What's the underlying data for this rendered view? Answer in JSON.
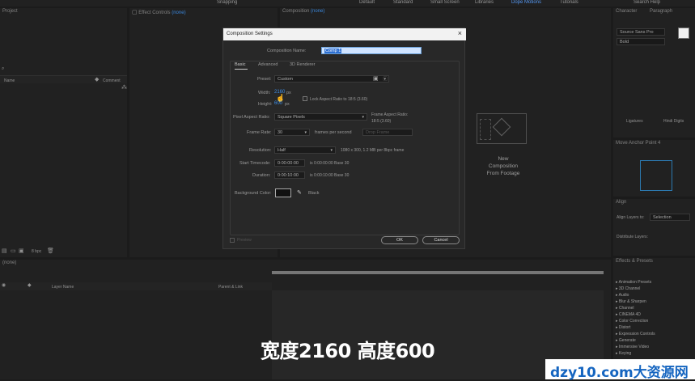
{
  "workspace": {
    "tabs": [
      "Default",
      "Standard",
      "Small Screen",
      "Libraries",
      "Dope Motions",
      "Tutorials"
    ],
    "active": "Dope Motions",
    "search": "Search Help",
    "snapping": "Snapping"
  },
  "panels": {
    "project": "Project",
    "effect_controls": "Effect Controls",
    "effect_controls_value": "(none)",
    "composition": "Composition",
    "composition_value": "(none)",
    "character": "Character",
    "paragraph": "Paragraph",
    "font": "Source Sans Pro",
    "font_style": "Bold",
    "align": "Align",
    "align_layers_to": "Align Layers to:",
    "align_target": "Selection",
    "distribute_layers": "Distribute Layers:",
    "ligatures": "Ligatures",
    "hindi_digits": "Hindi Digits",
    "anchor_panel": "Move Anchor Point 4",
    "effects_presets": "Effects & Presets",
    "timeline": "(none)",
    "bpc": "8 bpc"
  },
  "project_columns": {
    "name": "Name",
    "comment": "Comment"
  },
  "timeline_columns": {
    "layer_name": "Layer Name",
    "parent": "Parent & Link"
  },
  "comp_placeholder": {
    "line1": "New",
    "line2": "Composition",
    "line3": "From Footage"
  },
  "dialog": {
    "title": "Composition Settings",
    "close": "×",
    "comp_name_label": "Composition Name:",
    "comp_name_value": "Comp 1",
    "tabs": [
      "Basic",
      "Advanced",
      "3D Renderer"
    ],
    "preset_label": "Preset:",
    "preset_value": "Custom",
    "width_label": "Width:",
    "width_value": "2160",
    "width_unit": "px",
    "height_label": "Height:",
    "height_value": "600",
    "height_unit": "px",
    "lock_aspect": "Lock Aspect Ratio to 18:5 (3.60)",
    "par_label": "Pixel Aspect Ratio:",
    "par_value": "Square Pixels",
    "far_label": "Frame Aspect Ratio:",
    "far_value": "18:5 (3.60)",
    "fps_label": "Frame Rate:",
    "fps_value": "30",
    "fps_unit": "frames per second",
    "drop_frame": "Drop Frame",
    "resolution_label": "Resolution:",
    "resolution_value": "Half",
    "resolution_info": "1080 x 300, 1.2 MB per 8bpc frame",
    "start_tc_label": "Start Timecode:",
    "start_tc_value": "0:00:00:00",
    "start_tc_info": "is 0:00:00:00  Base 30",
    "duration_label": "Duration:",
    "duration_value": "0:00:10:00",
    "duration_info": "is 0:00:10:00  Base 30",
    "bg_label": "Background Color:",
    "bg_value": "Black",
    "bg_color": "#111111",
    "preview": "Preview",
    "ok": "OK",
    "cancel": "Cancel"
  },
  "effects_list": [
    "Animation Presets",
    "3D Channel",
    "Audio",
    "Blur & Sharpen",
    "Channel",
    "CINEMA 4D",
    "Color Correction",
    "Distort",
    "Expression Controls",
    "Generate",
    "Immersive Video",
    "Keying"
  ],
  "subtitle": "宽度2160 高度600",
  "watermark": "dzy10.com大资源网"
}
